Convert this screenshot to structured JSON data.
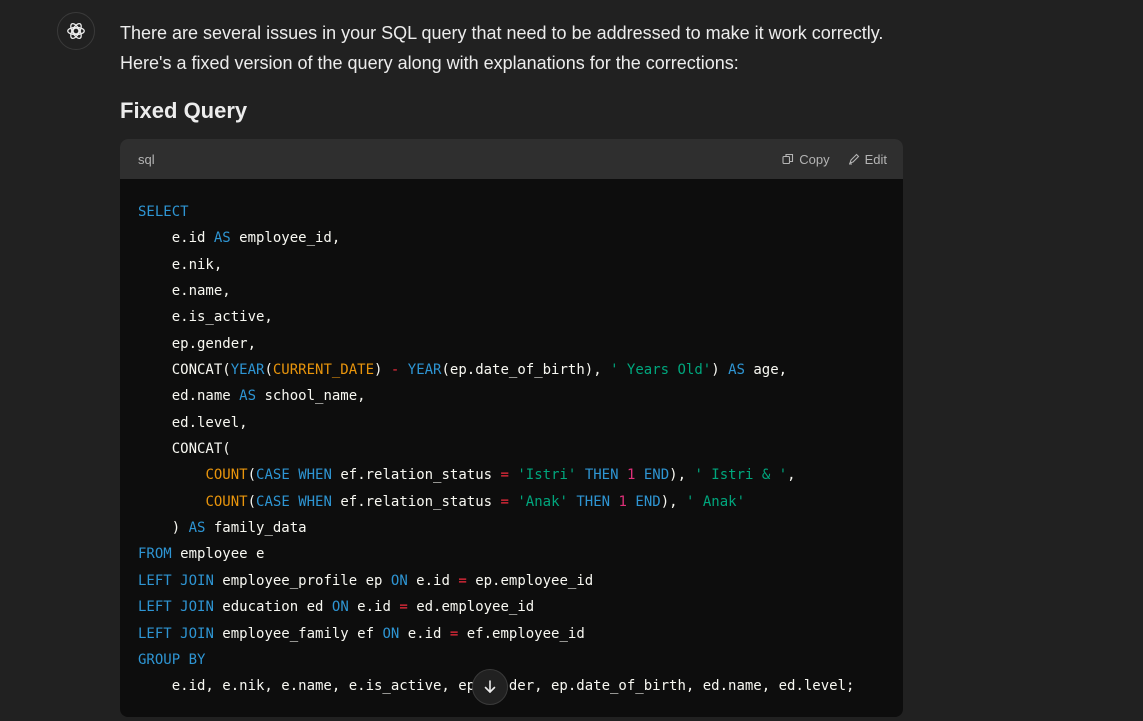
{
  "message": {
    "line1": "There are several issues in your SQL query that need to be addressed to make it work correctly.",
    "line2": "Here's a fixed version of the query along with explanations for the corrections:"
  },
  "heading": "Fixed Query",
  "code": {
    "language": "sql",
    "copy_label": "Copy",
    "edit_label": "Edit"
  },
  "icons": {
    "avatar": "chatgpt-logo-icon",
    "copy": "copy-icon",
    "edit": "edit-icon",
    "scroll": "arrow-down-icon"
  },
  "colors": {
    "background": "#212121",
    "code_bg": "#0d0d0d",
    "code_header": "#2f2f2f",
    "keyword": "#2e95d3",
    "builtin": "#e9950c",
    "string": "#00a67d",
    "number": "#df3079"
  }
}
